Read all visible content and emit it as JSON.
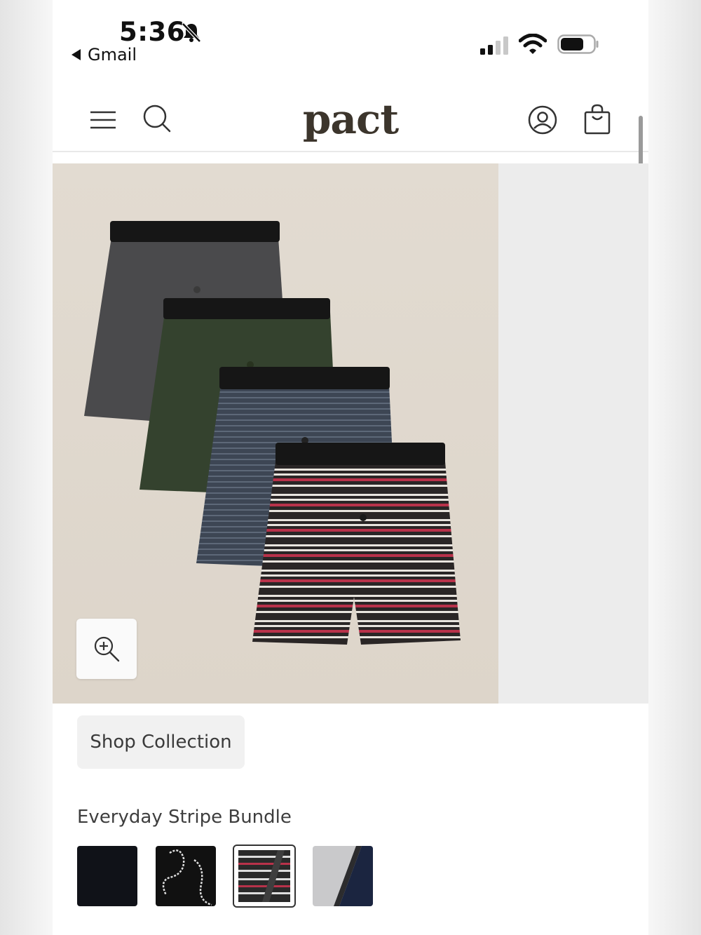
{
  "status_bar": {
    "time": "5:36",
    "back_label": "Gmail",
    "icons": [
      "bell-slash-icon",
      "cellular-signal-icon",
      "wifi-icon",
      "battery-icon"
    ]
  },
  "header": {
    "logo": "pact",
    "icons": [
      "menu-icon",
      "search-icon",
      "account-icon",
      "bag-icon"
    ]
  },
  "product": {
    "zoom_icon": "zoom-in-icon",
    "shop_collection_label": "Shop Collection",
    "bundle_title": "Everyday Stripe Bundle",
    "swatches": [
      {
        "name": "swatch-black",
        "selected": false
      },
      {
        "name": "swatch-black-pattern",
        "selected": false
      },
      {
        "name": "swatch-stripe",
        "selected": true
      },
      {
        "name": "swatch-grey-navy",
        "selected": false
      }
    ]
  },
  "colors": {
    "logo": "#3c352c",
    "hero_bg": "#e2dbd1",
    "button_bg": "#f1f1f1",
    "stripe_red": "#b8324a"
  }
}
